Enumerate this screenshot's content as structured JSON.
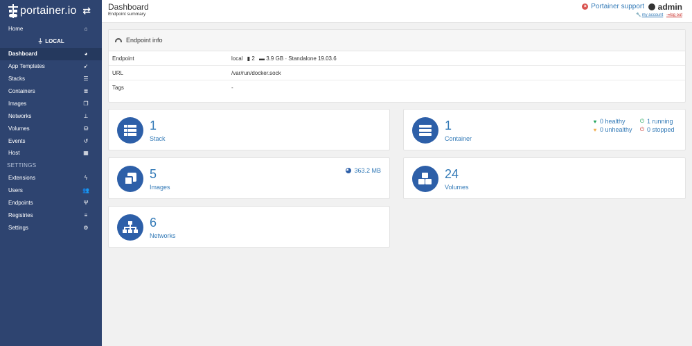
{
  "sidebar": {
    "brand": "portainer.io",
    "toggle_icon": "exchange-icon",
    "home_label": "Home",
    "endpoint_label": "LOCAL",
    "items": [
      {
        "label": "Dashboard",
        "icon": "dashboard-icon",
        "active": true
      },
      {
        "label": "App Templates",
        "icon": "rocket-icon"
      },
      {
        "label": "Stacks",
        "icon": "list-icon"
      },
      {
        "label": "Containers",
        "icon": "server-icon"
      },
      {
        "label": "Images",
        "icon": "clone-icon"
      },
      {
        "label": "Networks",
        "icon": "sitemap-icon"
      },
      {
        "label": "Volumes",
        "icon": "cubes-icon"
      },
      {
        "label": "Events",
        "icon": "history-icon"
      },
      {
        "label": "Host",
        "icon": "th-icon"
      }
    ],
    "settings_heading": "SETTINGS",
    "settings_items": [
      {
        "label": "Extensions",
        "icon": "bolt-icon"
      },
      {
        "label": "Users",
        "icon": "users-icon"
      },
      {
        "label": "Endpoints",
        "icon": "plug-icon"
      },
      {
        "label": "Registries",
        "icon": "database-icon"
      },
      {
        "label": "Settings",
        "icon": "cogs-icon"
      }
    ]
  },
  "header": {
    "title": "Dashboard",
    "subtitle": "Endpoint summary",
    "support": "Portainer support",
    "user": "admin",
    "my_account": "my account",
    "log_out": "log out"
  },
  "endpoint_info": {
    "title": "Endpoint info",
    "rows": [
      {
        "key": "Endpoint",
        "name": "local",
        "cpu": "2",
        "memory": "3.9 GB",
        "sep": " - ",
        "type": "Standalone 19.03.6"
      },
      {
        "key": "URL",
        "value": "/var/run/docker.sock"
      },
      {
        "key": "Tags",
        "value": "-"
      }
    ]
  },
  "stats": {
    "stack": {
      "count": "1",
      "label": "Stack"
    },
    "container": {
      "count": "1",
      "label": "Container",
      "healthy": "0 healthy",
      "unhealthy": "0 unhealthy",
      "running": "1 running",
      "stopped": "0 stopped"
    },
    "images": {
      "count": "5",
      "label": "Images",
      "size": "363.2 MB"
    },
    "volumes": {
      "count": "24",
      "label": "Volumes"
    },
    "networks": {
      "count": "6",
      "label": "Networks"
    }
  },
  "colors": {
    "sidebar_bg": "#2e4470",
    "accent": "#337ab7",
    "circle": "#2d5fa8",
    "healthy": "#22a45b",
    "unhealthy": "#f0ad4e",
    "stopped": "#c9302c"
  }
}
